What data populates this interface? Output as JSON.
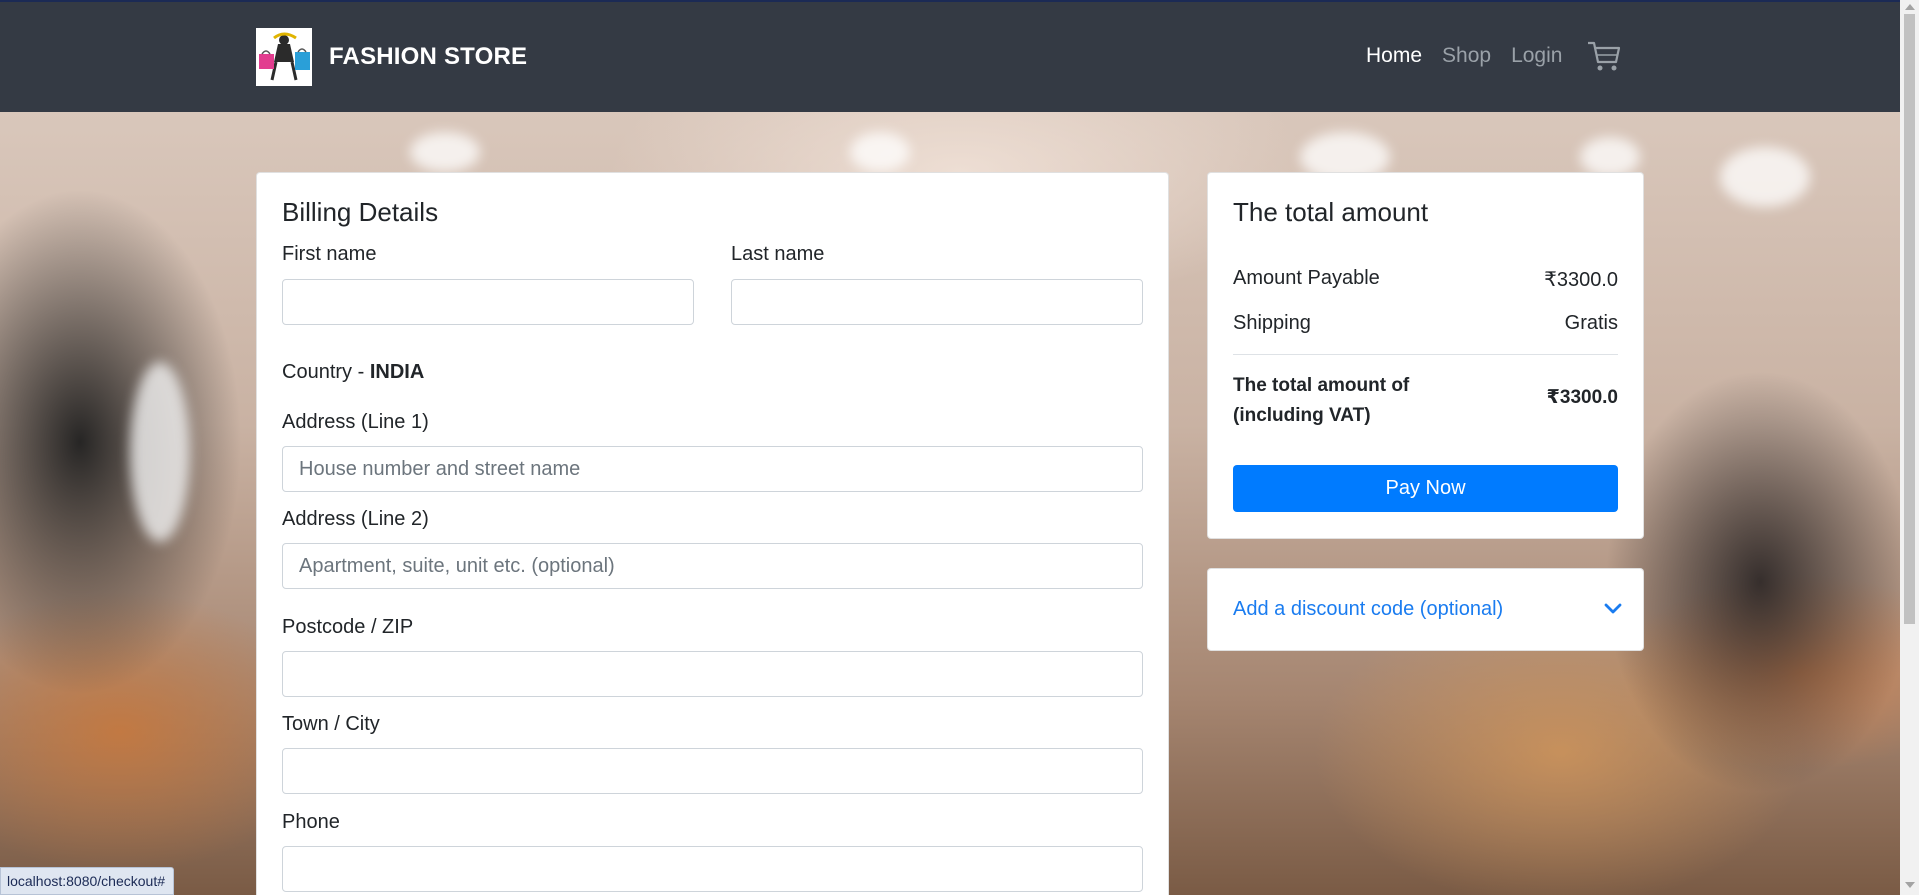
{
  "navbar": {
    "brand": "FASHION STORE",
    "links": [
      {
        "label": "Home",
        "active": true
      },
      {
        "label": "Shop",
        "active": false
      },
      {
        "label": "Login",
        "active": false
      }
    ],
    "cart_icon": "shopping-cart-icon"
  },
  "billing": {
    "title": "Billing Details",
    "first_name_label": "First name",
    "last_name_label": "Last name",
    "country_prefix": "Country - ",
    "country_value": "INDIA",
    "address1_label": "Address (Line 1)",
    "address1_placeholder": "House number and street name",
    "address2_label": "Address (Line 2)",
    "address2_placeholder": "Apartment, suite, unit etc. (optional)",
    "postcode_label": "Postcode / ZIP",
    "city_label": "Town / City",
    "phone_label": "Phone"
  },
  "summary": {
    "title": "The total amount",
    "amount_payable_label": "Amount Payable",
    "amount_payable_value": "₹3300.0",
    "shipping_label": "Shipping",
    "shipping_value": "Gratis",
    "total_label": "The total amount of (including VAT)",
    "total_value": "₹3300.0",
    "pay_button": "Pay Now"
  },
  "discount": {
    "label": "Add a discount code (optional)",
    "icon": "chevron-down-icon"
  },
  "status_bar": {
    "url": "localhost:8080/checkout#"
  },
  "colors": {
    "navbar_bg": "#343a44",
    "primary": "#007bff",
    "link": "#1a7cf0"
  }
}
